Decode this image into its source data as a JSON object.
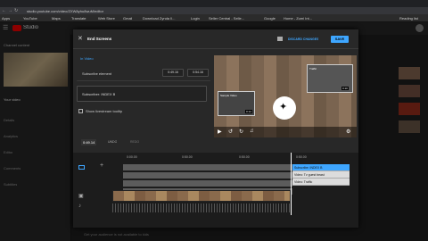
{
  "browser": {
    "url": "studio.youtube.com/video/ZXWAyhu8wuM/editor",
    "bookmarks": [
      "Apps",
      "YouTube",
      "Maps",
      "Translate",
      "Web Store",
      "Gmail",
      "Download Zynda Il...",
      "Login",
      "Seller Central - Selle...",
      "Google",
      "Home - Zumi Int...",
      "Reading list"
    ]
  },
  "studio": {
    "logo": "Studio",
    "channel_label": "Channel content",
    "your_video": "Your video",
    "side_items": [
      "Details",
      "Analytics",
      "Editor",
      "Comments",
      "Subtitles"
    ],
    "bottom_text": "Get your audience is not available to kids"
  },
  "editor": {
    "title": "End Screens",
    "discard_label": "DISCARD CHANGES",
    "save_label": "SAVE",
    "back_label": "In Video",
    "subscribe_row": {
      "label": "Subscribe element",
      "start": "0:49.16",
      "end": "0:54.16"
    },
    "subscriber_field": "Subscriber: INDEX B",
    "checkbox_label": "Show livestream tooltip",
    "timeline": {
      "current_time": "0:49.14",
      "undo_label": "UNDO",
      "redo_label": "REDO",
      "ticks": [
        "0:00.00",
        "0:50.00",
        "0:50.00",
        "0:50.00"
      ],
      "endcards": [
        "Subscribe: INDEX B",
        "Video: Tv guest beast",
        "Video: Traffic"
      ]
    },
    "preview": {
      "clip1_title": "Sample Video",
      "clip1_time": "0:14",
      "clip2_title": "Traffic",
      "clip2_time": "0:10"
    }
  },
  "colors": {
    "accent": "#3ea6ff",
    "brand": "#ff0000"
  }
}
